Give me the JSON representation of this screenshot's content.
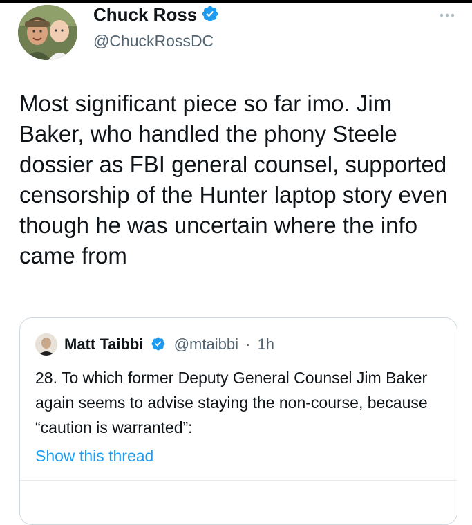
{
  "tweet": {
    "author": {
      "name": "Chuck Ross",
      "handle": "@ChuckRossDC",
      "verified": true
    },
    "more_icon": "more-options-icon",
    "text": "Most significant piece so far imo. Jim Baker, who handled the phony Steele dossier as FBI general counsel, supported censorship of the Hunter laptop story even though he was uncertain where the info came from"
  },
  "quote": {
    "author": {
      "name": "Matt Taibbi",
      "handle": "@mtaibbi",
      "separator": "·",
      "time": "1h",
      "verified": true
    },
    "text": "28. To which former Deputy General Counsel Jim Baker again seems to advise staying the non-course, because “caution is warranted”:",
    "show_thread": "Show this thread"
  },
  "colors": {
    "link": "#1d9bf0",
    "verified_badge": "#1d9bf0",
    "secondary_text": "#536471",
    "border": "#cfd9de"
  }
}
